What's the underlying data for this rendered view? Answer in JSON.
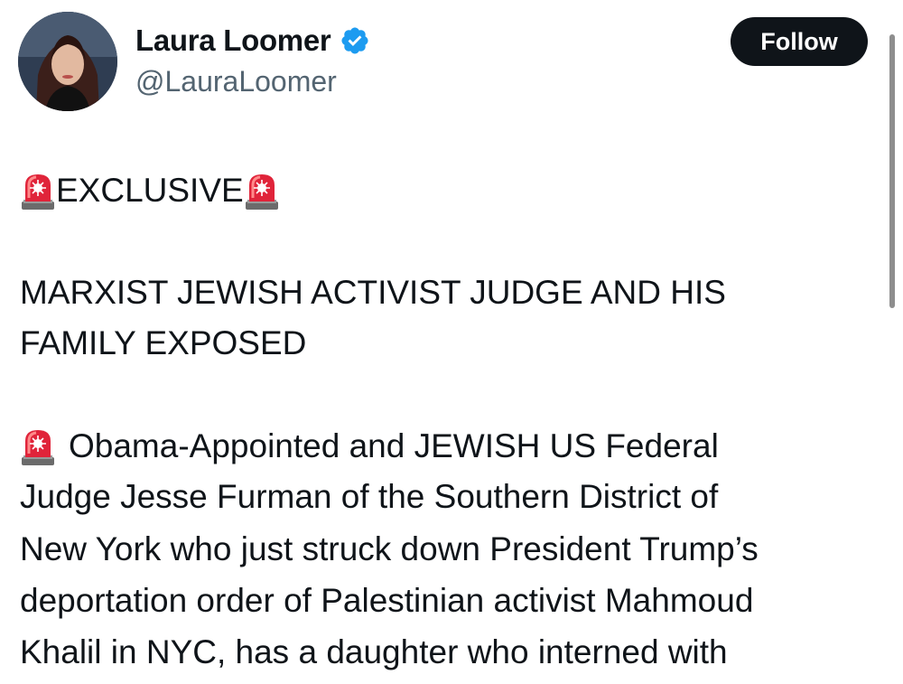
{
  "user": {
    "display_name": "Laura Loomer",
    "handle": "@LauraLoomer",
    "verified_icon": "verified-badge-icon",
    "avatar_icon": "profile-avatar"
  },
  "actions": {
    "follow_label": "Follow"
  },
  "tweet": {
    "siren_icon": "police-car-light-emoji",
    "line1": "EXCLUSIVE",
    "line2a": "MARXIST JEWISH ACTIVIST JUDGE AND HIS",
    "line2b": "FAMILY EXPOSED",
    "line3a": "Obama-Appointed and JEWISH US Federal",
    "line3b": "Judge Jesse Furman of the Southern District of",
    "line3c": "New York who just struck down President Trump’s",
    "line3d": "deportation order of Palestinian activist Mahmoud",
    "line3e": "Khalil in NYC, has a daughter who interned with"
  },
  "colors": {
    "text": "#0f1419",
    "handle": "#536471",
    "follow_bg": "#0f1419",
    "verified": "#1d9bf0",
    "siren_red": "#e0243a"
  }
}
